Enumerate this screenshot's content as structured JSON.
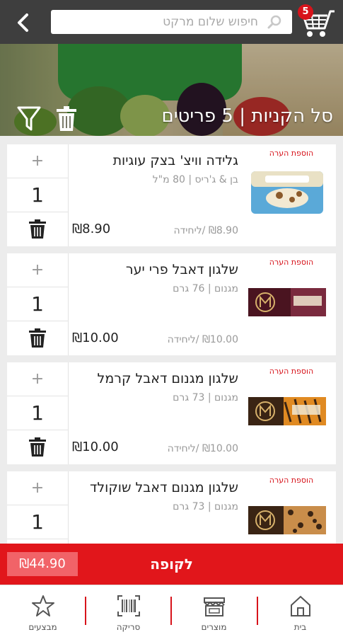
{
  "header": {
    "search_placeholder": "חיפוש שלום מרקט",
    "cart_count": "5"
  },
  "hero": {
    "title": "סל הקניות | 5 פריטים"
  },
  "items": [
    {
      "name": "גלידה וויצ' בצק עוגיות",
      "sub": "בן & ג'ריס | 80 מ\"ל",
      "unit_price": "₪8.90 /ליחידה",
      "price": "₪8.90",
      "qty": "1",
      "plus": "+",
      "note": "הוספת הערה"
    },
    {
      "name": "שלגון דאבל פרי יער",
      "sub": "מגנום | 76 גרם",
      "unit_price": "₪10.00 /ליחידה",
      "price": "₪10.00",
      "qty": "1",
      "plus": "+",
      "note": "הוספת הערה"
    },
    {
      "name": "שלגון מגנום דאבל קרמל",
      "sub": "מגנום | 73 גרם",
      "unit_price": "₪10.00 /ליחידה",
      "price": "₪10.00",
      "qty": "1",
      "plus": "+",
      "note": "הוספת הערה"
    },
    {
      "name": "שלגון מגנום דאבל שוקולד",
      "sub": "מגנום | 73 גרם",
      "unit_price": "",
      "price": "",
      "qty": "1",
      "plus": "+",
      "note": "הוספת הערה"
    }
  ],
  "checkout": {
    "label": "לקופה",
    "total": "₪44.90"
  },
  "nav": {
    "home": "בית",
    "products": "מוצרים",
    "scan": "סריקה",
    "deals": "מבצעים"
  },
  "colors": {
    "brand_red": "#e1161b",
    "topbar": "#3e3e3e"
  }
}
